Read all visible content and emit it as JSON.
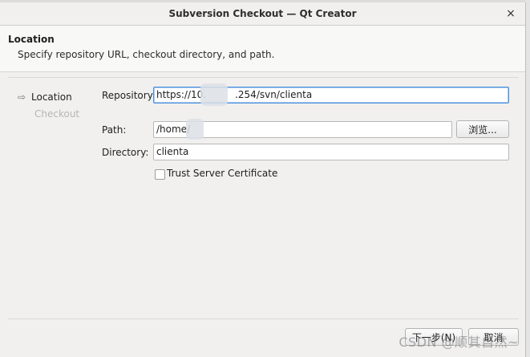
{
  "window": {
    "title": "Subversion Checkout — Qt Creator",
    "close_glyph": "×"
  },
  "header": {
    "title": "Location",
    "subtitle": "Specify repository URL, checkout directory, and path."
  },
  "steps": [
    {
      "label": "Location",
      "active": true,
      "icon": "arrow-right-icon",
      "icon_glyph": "⇨"
    },
    {
      "label": "Checkout",
      "active": false
    }
  ],
  "form": {
    "repository": {
      "label": "Repository:",
      "value": "https://10.      .254/svn/clienta"
    },
    "path": {
      "label": "Path:",
      "value": "/home/"
    },
    "browse_label": "浏览...",
    "directory": {
      "label": "Directory:",
      "value": "clienta"
    },
    "trust_cert": {
      "label": "Trust Server Certificate",
      "checked": false
    }
  },
  "buttons": {
    "next_label": "下一步(N)",
    "cancel_label": "取消"
  },
  "watermark": "CSDN @顺其自然~",
  "colors": {
    "focus_border": "#4a90d9",
    "inactive_step": "#b5b5b5"
  }
}
